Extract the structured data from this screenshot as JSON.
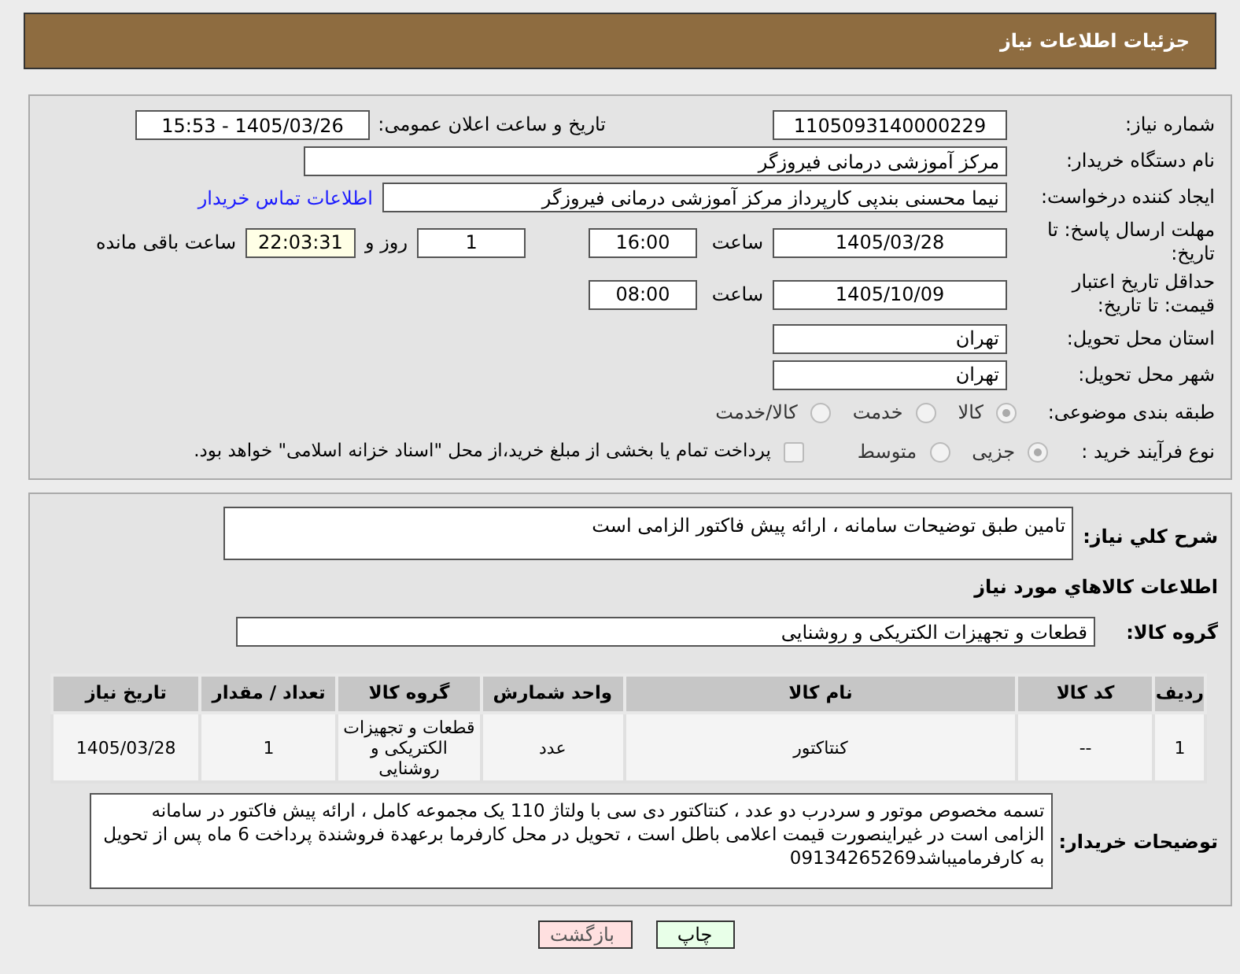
{
  "header": {
    "title": "جزئیات اطلاعات نیاز"
  },
  "need_number": {
    "label": "شماره نیاز:",
    "value": "1105093140000229"
  },
  "announce": {
    "label": "تاریخ و ساعت اعلان عمومی:",
    "value": "1405/03/26 - 15:53"
  },
  "buyer": {
    "label": "نام دستگاه خریدار:",
    "value": "مرکز آموزشی درمانی فیروزگر"
  },
  "creator": {
    "label": "ایجاد کننده درخواست:",
    "value": "نیما محسنی بندپی کارپرداز مرکز آموزشی درمانی فیروزگر",
    "link": "اطلاعات تماس خریدار"
  },
  "deadline": {
    "label": "مهلت ارسال پاسخ: تا تاریخ:",
    "date": "1405/03/28",
    "time_label": "ساعت",
    "time": "16:00",
    "days": "1",
    "days_label": "روز و",
    "remaining": "22:03:31",
    "remaining_label": "ساعت باقی مانده"
  },
  "validity": {
    "label": "حداقل تاریخ اعتبار قیمت: تا تاریخ:",
    "date": "1405/10/09",
    "time_label": "ساعت",
    "time": "08:00"
  },
  "province": {
    "label": "استان محل تحویل:",
    "value": "تهران"
  },
  "city": {
    "label": "شهر محل تحویل:",
    "value": "تهران"
  },
  "category": {
    "label": "طبقه بندی موضوعی:",
    "options": [
      {
        "label": "کالا",
        "selected": true
      },
      {
        "label": "خدمت",
        "selected": false
      },
      {
        "label": "کالا/خدمت",
        "selected": false
      }
    ]
  },
  "process": {
    "label": "نوع فرآیند خرید :",
    "options": [
      {
        "label": "جزیی",
        "selected": true
      },
      {
        "label": "متوسط",
        "selected": false
      }
    ],
    "payment": {
      "label": "پرداخت تمام یا بخشی از مبلغ خرید،از محل \"اسناد خزانه اسلامی\" خواهد بود.",
      "checked": false
    }
  },
  "description": {
    "label": "شرح کلي نياز:",
    "value": "تامین طبق توضیحات سامانه ، ارائه پیش فاکتور الزامی است"
  },
  "goods_title": "اطلاعات کالاهاي مورد نياز",
  "goods_group": {
    "label": "گروه کالا:",
    "value": "قطعات و تجهیزات الکتریکی و روشنایی"
  },
  "table": {
    "columns": [
      "ردیف",
      "کد کالا",
      "نام کالا",
      "واحد شمارش",
      "گروه کالا",
      "تعداد / مقدار",
      "تاریخ نیاز"
    ],
    "rows": [
      [
        "1",
        "--",
        "کنتاکتور",
        "عدد",
        "قطعات و تجهیزات الکتریکی و روشنایی",
        "1",
        "1405/03/28"
      ]
    ]
  },
  "notes": {
    "label": "توضیحات خریدار:",
    "value": "تسمه مخصوص موتور و سردرب دو عدد ، کنتاکتور دی سی با ولتاژ 110 یک مجموعه کامل ، ارائه پیش فاکتور در سامانه الزامی است در غیراینصورت قیمت اعلامی باطل است ، تحویل در محل کارفرما برعهدة فروشندة پرداخت 6 ماه پس از تحویل به کارفرمامیباشد09134265269"
  },
  "buttons": [
    {
      "label": "چاپ",
      "kind": "print"
    },
    {
      "label": "بازگشت",
      "kind": "back"
    }
  ]
}
